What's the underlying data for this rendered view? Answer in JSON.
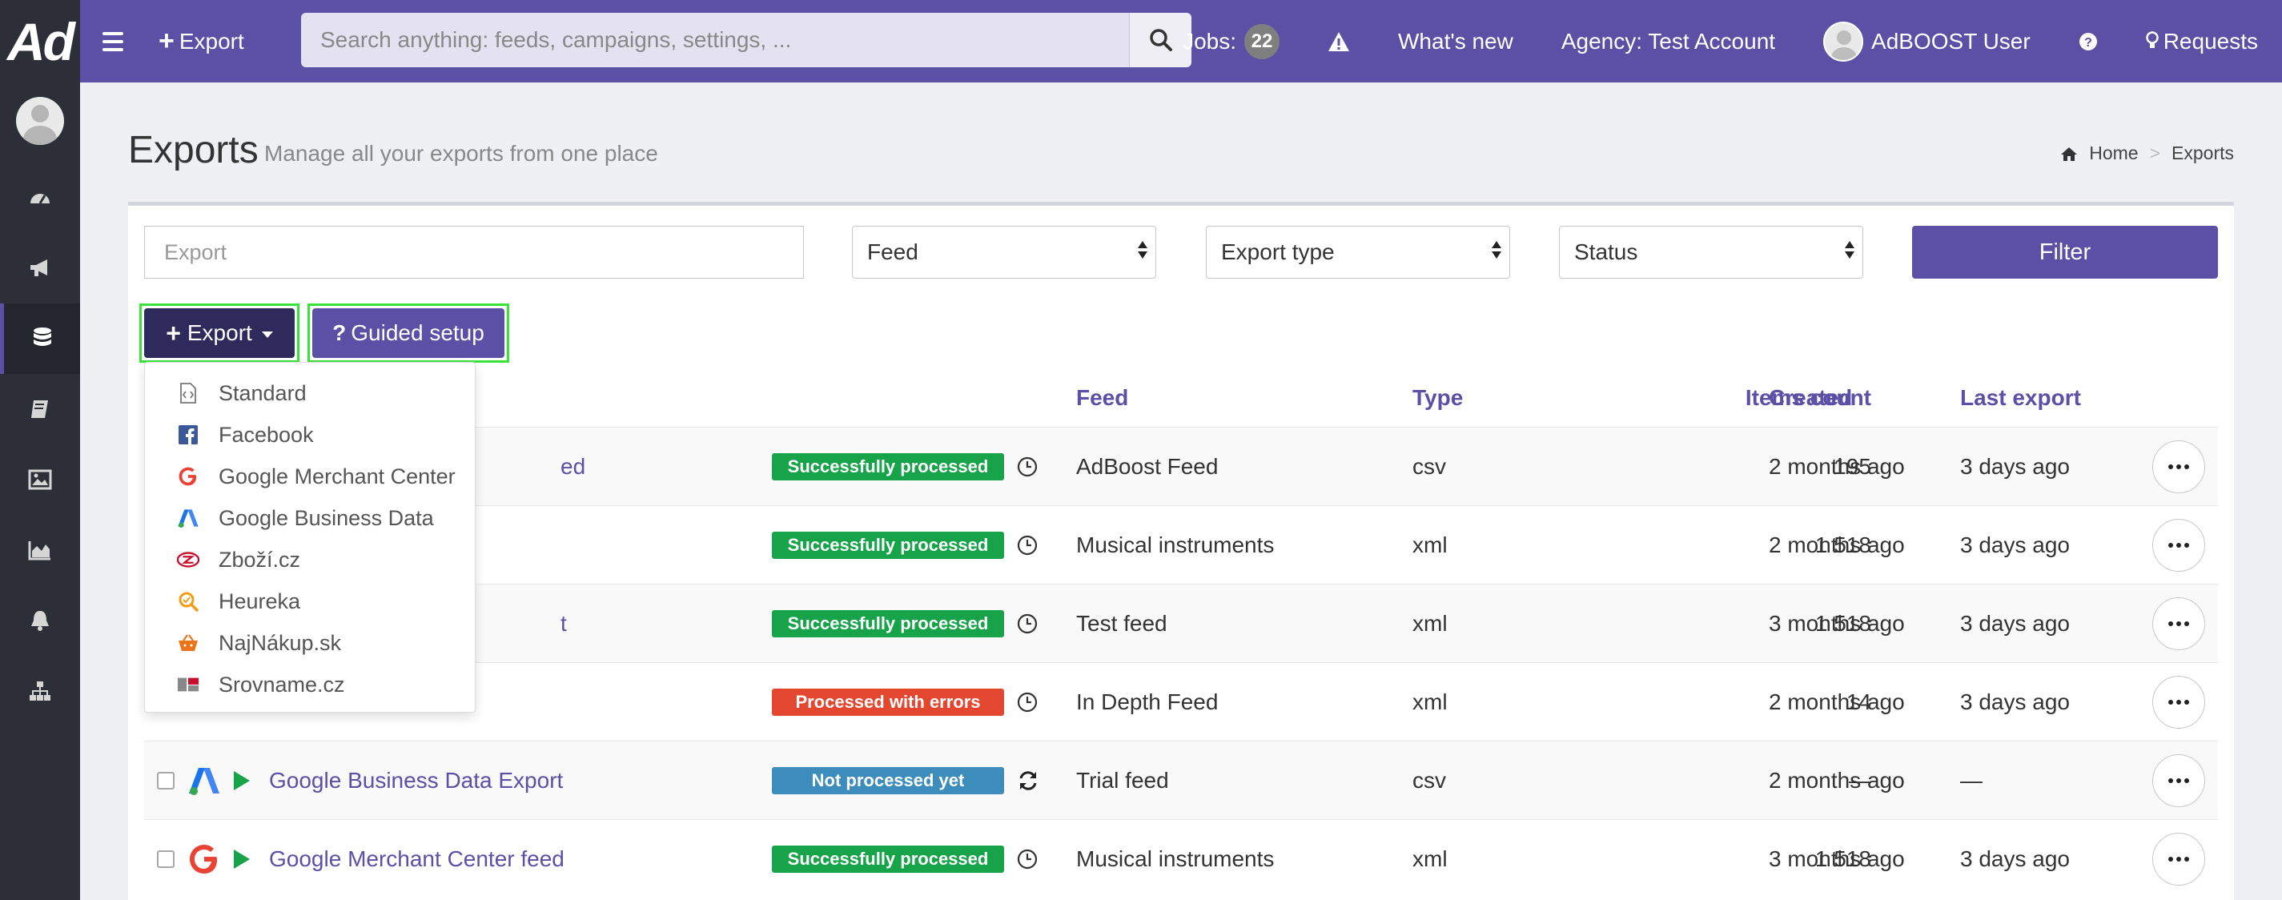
{
  "topbar": {
    "logo_text": "Ad",
    "export_label": "Export",
    "search_placeholder": "Search anything: feeds, campaigns, settings, ...",
    "jobs_label": "Jobs:",
    "jobs_count": "22",
    "whats_new": "What's new",
    "agency": "Agency: Test Account",
    "user_name": "AdBOOST User",
    "requests": "Requests"
  },
  "sidebar": {
    "items": [
      {
        "icon": "dashboard-icon"
      },
      {
        "icon": "megaphone-icon"
      },
      {
        "icon": "database-icon",
        "active": true
      },
      {
        "icon": "book-icon"
      },
      {
        "icon": "image-icon"
      },
      {
        "icon": "area-chart-icon"
      },
      {
        "icon": "bell-icon"
      },
      {
        "icon": "sitemap-icon"
      }
    ]
  },
  "header": {
    "title": "Exports",
    "subtitle": "Manage all your exports from one place",
    "breadcrumb": {
      "home": "Home",
      "current": "Exports"
    }
  },
  "filters": {
    "export_placeholder": "Export",
    "feed": "Feed",
    "export_type": "Export type",
    "status": "Status",
    "filter_button": "Filter"
  },
  "actions": {
    "export_button": "Export",
    "guided_setup": "Guided setup"
  },
  "dropdown": {
    "items": [
      "Standard",
      "Facebook",
      "Google Merchant Center",
      "Google Business Data",
      "Zboží.cz",
      "Heureka",
      "NajNákup.sk",
      "Srovname.cz"
    ]
  },
  "table": {
    "headers": {
      "feed": "Feed",
      "type": "Type",
      "items_count": "Items count",
      "created": "Created",
      "last_export": "Last export"
    },
    "rows": [
      {
        "name_fragment": "ed",
        "status": "Successfully processed",
        "status_color": "#16a34a",
        "feed": "AdBoost Feed",
        "type": "csv",
        "items": "195",
        "created": "2 months ago",
        "last_export": "3 days ago"
      },
      {
        "name_fragment": "",
        "status": "Successfully processed",
        "status_color": "#16a34a",
        "feed": "Musical instruments",
        "type": "xml",
        "items": "1 518",
        "created": "2 months ago",
        "last_export": "3 days ago"
      },
      {
        "name_fragment": "t",
        "status": "Successfully processed",
        "status_color": "#16a34a",
        "feed": "Test feed",
        "type": "xml",
        "items": "1 518",
        "created": "3 months ago",
        "last_export": "3 days ago"
      },
      {
        "name_fragment": "",
        "status": "Processed with errors",
        "status_color": "#e4472f",
        "feed": "In Depth Feed",
        "type": "xml",
        "items": "14",
        "created": "2 months ago",
        "last_export": "3 days ago"
      },
      {
        "name": "Google Business Data Export",
        "status": "Not processed yet",
        "status_color": "#3c8dbc",
        "feed": "Trial feed",
        "type": "csv",
        "items": "—",
        "created": "2 months ago",
        "last_export": "—"
      },
      {
        "name": "Google Merchant Center feed",
        "status": "Successfully processed",
        "status_color": "#16a34a",
        "feed": "Musical instruments",
        "type": "xml",
        "items": "1 518",
        "created": "3 months ago",
        "last_export": "3 days ago"
      }
    ]
  },
  "colors": {
    "brand": "#5b50a6",
    "brand_dark": "#2f2a5c",
    "sidebar": "#2c2f37",
    "success": "#16a34a",
    "error": "#e4472f",
    "info": "#3c8dbc",
    "highlight": "#39e339"
  }
}
